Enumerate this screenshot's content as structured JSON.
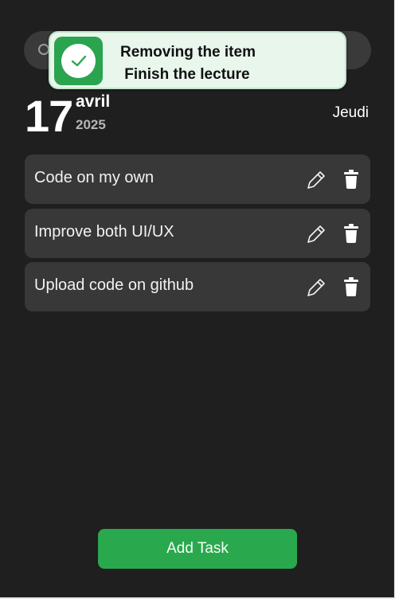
{
  "search": {
    "placeholder": "",
    "value": ""
  },
  "toast": {
    "message": "Removing the item\n Finish the lecture",
    "accent_color": "#2aa44f",
    "icon": "check-icon"
  },
  "date": {
    "day": "17",
    "month": "avril",
    "year": "2025",
    "weekday": "Jeudi"
  },
  "tasks": [
    {
      "label": "Code on my own"
    },
    {
      "label": "Improve both UI/UX"
    },
    {
      "label": "Upload code on github"
    }
  ],
  "add_button": {
    "label": "Add Task",
    "color": "#2aa84e"
  },
  "icons": {
    "edit": "pencil-icon",
    "delete": "trash-icon",
    "search": "search-icon"
  }
}
